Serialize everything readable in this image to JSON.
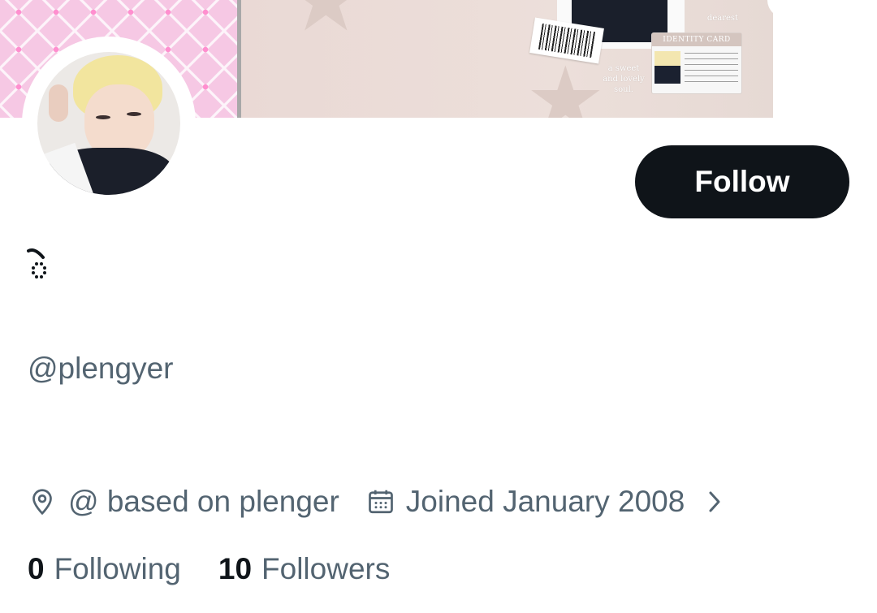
{
  "profile": {
    "handle": "@plengyer",
    "follow_label": "Follow",
    "location": "@ based on plenger",
    "joined": "Joined January 2008",
    "following_count": "0",
    "following_label": "Following",
    "followers_count": "10",
    "followers_label": "Followers"
  },
  "banner": {
    "dearest_text": "dearest",
    "id_card_title": "IDENTITY CARD",
    "tagline": "a sweet and lovely soul."
  },
  "icons": {
    "location": "map-pin-icon",
    "joined": "calendar-icon",
    "more": "chevron-right-icon"
  },
  "colors": {
    "primary_text": "#0f1419",
    "secondary_text": "#536471",
    "button_bg": "#0f1419",
    "button_text": "#ffffff"
  }
}
